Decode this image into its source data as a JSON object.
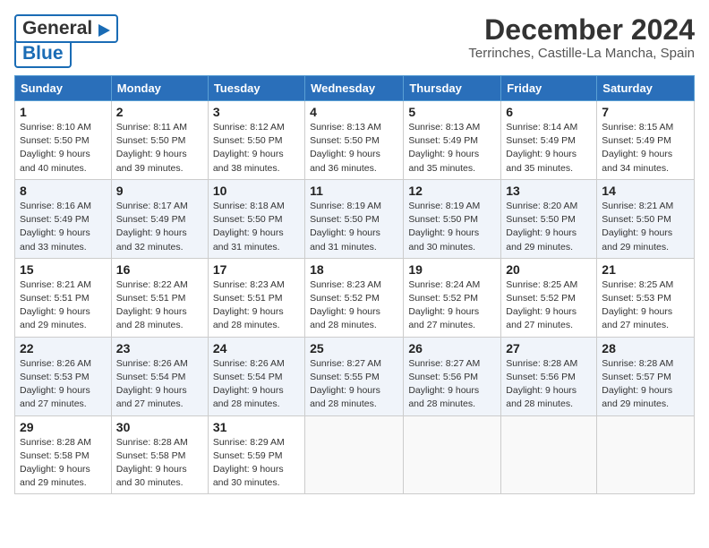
{
  "header": {
    "logo_line1": "General",
    "logo_line2": "Blue",
    "month_year": "December 2024",
    "location": "Terrinches, Castille-La Mancha, Spain"
  },
  "weekdays": [
    "Sunday",
    "Monday",
    "Tuesday",
    "Wednesday",
    "Thursday",
    "Friday",
    "Saturday"
  ],
  "weeks": [
    [
      {
        "day": "1",
        "info": "Sunrise: 8:10 AM\nSunset: 5:50 PM\nDaylight: 9 hours\nand 40 minutes."
      },
      {
        "day": "2",
        "info": "Sunrise: 8:11 AM\nSunset: 5:50 PM\nDaylight: 9 hours\nand 39 minutes."
      },
      {
        "day": "3",
        "info": "Sunrise: 8:12 AM\nSunset: 5:50 PM\nDaylight: 9 hours\nand 38 minutes."
      },
      {
        "day": "4",
        "info": "Sunrise: 8:13 AM\nSunset: 5:50 PM\nDaylight: 9 hours\nand 36 minutes."
      },
      {
        "day": "5",
        "info": "Sunrise: 8:13 AM\nSunset: 5:49 PM\nDaylight: 9 hours\nand 35 minutes."
      },
      {
        "day": "6",
        "info": "Sunrise: 8:14 AM\nSunset: 5:49 PM\nDaylight: 9 hours\nand 35 minutes."
      },
      {
        "day": "7",
        "info": "Sunrise: 8:15 AM\nSunset: 5:49 PM\nDaylight: 9 hours\nand 34 minutes."
      }
    ],
    [
      {
        "day": "8",
        "info": "Sunrise: 8:16 AM\nSunset: 5:49 PM\nDaylight: 9 hours\nand 33 minutes."
      },
      {
        "day": "9",
        "info": "Sunrise: 8:17 AM\nSunset: 5:49 PM\nDaylight: 9 hours\nand 32 minutes."
      },
      {
        "day": "10",
        "info": "Sunrise: 8:18 AM\nSunset: 5:50 PM\nDaylight: 9 hours\nand 31 minutes."
      },
      {
        "day": "11",
        "info": "Sunrise: 8:19 AM\nSunset: 5:50 PM\nDaylight: 9 hours\nand 31 minutes."
      },
      {
        "day": "12",
        "info": "Sunrise: 8:19 AM\nSunset: 5:50 PM\nDaylight: 9 hours\nand 30 minutes."
      },
      {
        "day": "13",
        "info": "Sunrise: 8:20 AM\nSunset: 5:50 PM\nDaylight: 9 hours\nand 29 minutes."
      },
      {
        "day": "14",
        "info": "Sunrise: 8:21 AM\nSunset: 5:50 PM\nDaylight: 9 hours\nand 29 minutes."
      }
    ],
    [
      {
        "day": "15",
        "info": "Sunrise: 8:21 AM\nSunset: 5:51 PM\nDaylight: 9 hours\nand 29 minutes."
      },
      {
        "day": "16",
        "info": "Sunrise: 8:22 AM\nSunset: 5:51 PM\nDaylight: 9 hours\nand 28 minutes."
      },
      {
        "day": "17",
        "info": "Sunrise: 8:23 AM\nSunset: 5:51 PM\nDaylight: 9 hours\nand 28 minutes."
      },
      {
        "day": "18",
        "info": "Sunrise: 8:23 AM\nSunset: 5:52 PM\nDaylight: 9 hours\nand 28 minutes."
      },
      {
        "day": "19",
        "info": "Sunrise: 8:24 AM\nSunset: 5:52 PM\nDaylight: 9 hours\nand 27 minutes."
      },
      {
        "day": "20",
        "info": "Sunrise: 8:25 AM\nSunset: 5:52 PM\nDaylight: 9 hours\nand 27 minutes."
      },
      {
        "day": "21",
        "info": "Sunrise: 8:25 AM\nSunset: 5:53 PM\nDaylight: 9 hours\nand 27 minutes."
      }
    ],
    [
      {
        "day": "22",
        "info": "Sunrise: 8:26 AM\nSunset: 5:53 PM\nDaylight: 9 hours\nand 27 minutes."
      },
      {
        "day": "23",
        "info": "Sunrise: 8:26 AM\nSunset: 5:54 PM\nDaylight: 9 hours\nand 27 minutes."
      },
      {
        "day": "24",
        "info": "Sunrise: 8:26 AM\nSunset: 5:54 PM\nDaylight: 9 hours\nand 28 minutes."
      },
      {
        "day": "25",
        "info": "Sunrise: 8:27 AM\nSunset: 5:55 PM\nDaylight: 9 hours\nand 28 minutes."
      },
      {
        "day": "26",
        "info": "Sunrise: 8:27 AM\nSunset: 5:56 PM\nDaylight: 9 hours\nand 28 minutes."
      },
      {
        "day": "27",
        "info": "Sunrise: 8:28 AM\nSunset: 5:56 PM\nDaylight: 9 hours\nand 28 minutes."
      },
      {
        "day": "28",
        "info": "Sunrise: 8:28 AM\nSunset: 5:57 PM\nDaylight: 9 hours\nand 29 minutes."
      }
    ],
    [
      {
        "day": "29",
        "info": "Sunrise: 8:28 AM\nSunset: 5:58 PM\nDaylight: 9 hours\nand 29 minutes."
      },
      {
        "day": "30",
        "info": "Sunrise: 8:28 AM\nSunset: 5:58 PM\nDaylight: 9 hours\nand 30 minutes."
      },
      {
        "day": "31",
        "info": "Sunrise: 8:29 AM\nSunset: 5:59 PM\nDaylight: 9 hours\nand 30 minutes."
      },
      {
        "day": "",
        "info": ""
      },
      {
        "day": "",
        "info": ""
      },
      {
        "day": "",
        "info": ""
      },
      {
        "day": "",
        "info": ""
      }
    ]
  ]
}
